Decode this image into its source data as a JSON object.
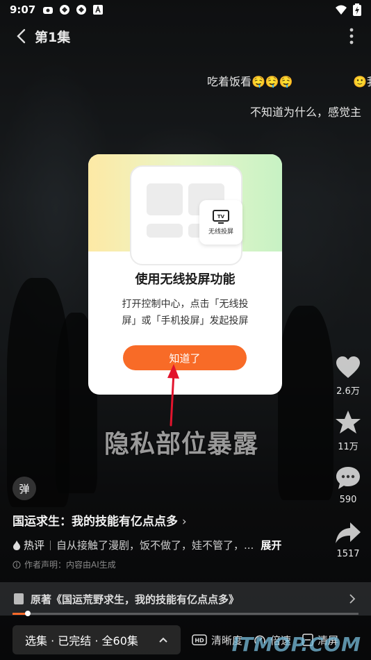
{
  "status_bar": {
    "time": "9:07"
  },
  "header": {
    "episode_title": "第1集"
  },
  "danmaku": [
    {
      "text": "吃着饭看🤤🤤🤤"
    },
    {
      "text": "🙂我"
    },
    {
      "text": "不知道为什么，感觉主"
    }
  ],
  "video": {
    "overlay_text": "隐私部位暴露"
  },
  "side_actions": {
    "like_count": "2.6万",
    "favorite_count": "11万",
    "comment_count": "590",
    "share_count": "1517"
  },
  "danmu_toggle_label": "弹",
  "show": {
    "title": "国运求生：我的技能有亿点点多",
    "hot_label": "热评",
    "hot_comment": "自从接触了漫剧，饭不做了，娃不管了，...",
    "expand_label": "展开",
    "declaration": "作者声明：内容由AI生成",
    "source_text": "原著《国运荒野求生，我的技能有亿点点多》",
    "progress_fraction": 0.045
  },
  "bottom_bar": {
    "episode_select": "选集 · 已完结 · 全60集",
    "quality_label": "清晰度",
    "speed_label": "倍速",
    "clear_label": "清屏"
  },
  "dialog": {
    "cast_card_label": "无线投屏",
    "title": "使用无线投屏功能",
    "description": "打开控制中心，点击「无线投屏」或「手机投屏」发起投屏",
    "confirm_label": "知道了"
  },
  "watermark": "ITMOP.COM",
  "colors": {
    "accent": "#f86b27"
  }
}
